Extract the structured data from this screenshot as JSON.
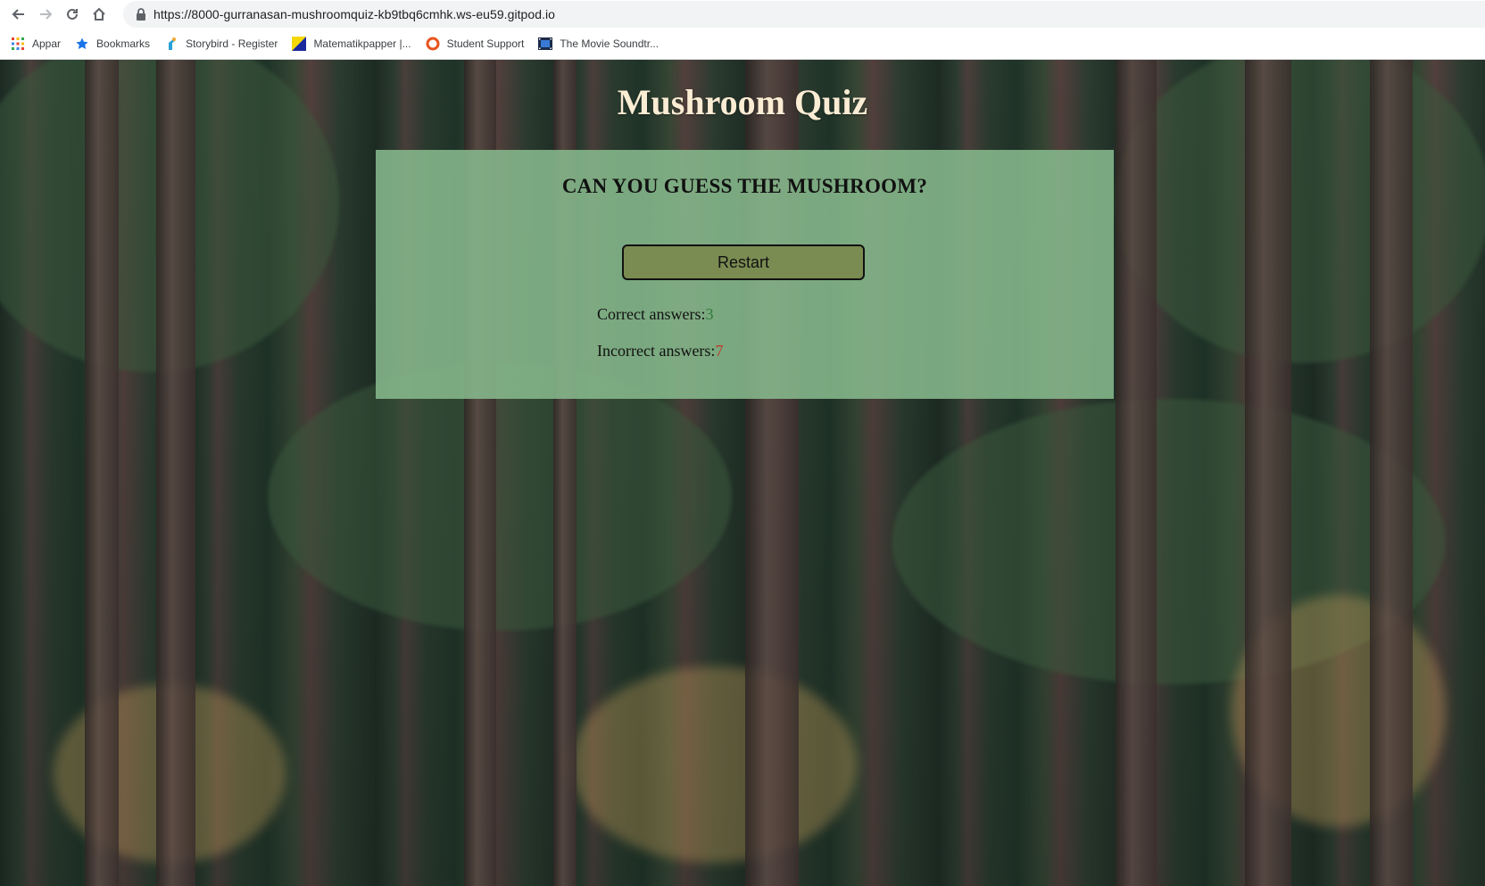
{
  "browser": {
    "url": "https://8000-gurranasan-mushroomquiz-kb9tbq6cmhk.ws-eu59.gitpod.io",
    "bookmarks": [
      {
        "label": "Appar",
        "icon": "apps-grid-icon"
      },
      {
        "label": "Bookmarks",
        "icon": "star-icon"
      },
      {
        "label": "Storybird - Register",
        "icon": "storybird-icon"
      },
      {
        "label": "Matematikpapper |...",
        "icon": "matematikpapper-icon"
      },
      {
        "label": "Student Support",
        "icon": "student-support-icon"
      },
      {
        "label": "The Movie Soundtr...",
        "icon": "film-icon"
      }
    ]
  },
  "page": {
    "title": "Mushroom Quiz",
    "card": {
      "heading": "CAN YOU GUESS THE MUSHROOM?",
      "restart_label": "Restart",
      "correct_label": "Correct answers:",
      "correct_value": "3",
      "incorrect_label": "Incorrect answers:",
      "incorrect_value": "7"
    }
  },
  "colors": {
    "title": "#fbecd4",
    "card_background": "#86b88c",
    "button_background": "#7a8c52",
    "correct": "#2f7d3a",
    "incorrect": "#c0392b"
  }
}
